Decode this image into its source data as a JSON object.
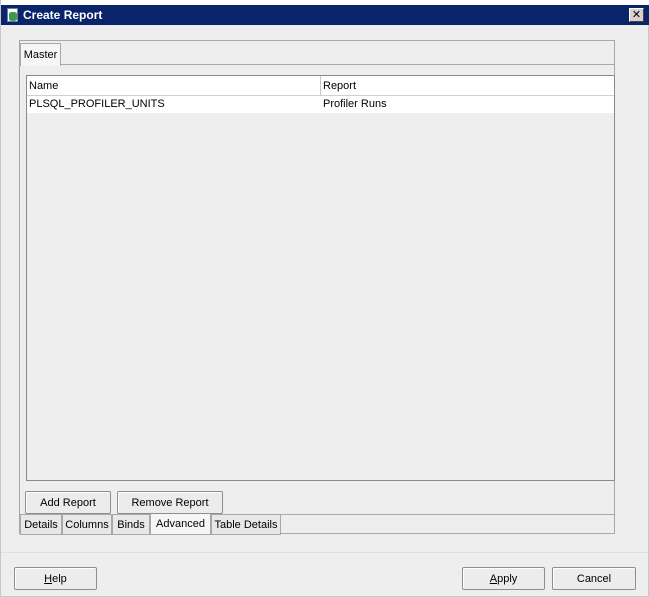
{
  "window": {
    "title": "Create Report",
    "close_glyph": "✕"
  },
  "outer_tabs": [
    {
      "label": "Master",
      "selected": true
    }
  ],
  "table": {
    "columns": [
      "Name",
      "Report"
    ],
    "rows": [
      {
        "name": "PLSQL_PROFILER_UNITS",
        "report": "Profiler Runs"
      }
    ]
  },
  "actions": {
    "add_report": "Add Report",
    "remove_report": "Remove Report"
  },
  "inner_tabs": [
    {
      "label": "Details",
      "selected": false
    },
    {
      "label": "Columns",
      "selected": false
    },
    {
      "label": "Binds",
      "selected": false
    },
    {
      "label": "Advanced",
      "selected": true
    },
    {
      "label": "Table Details",
      "selected": false
    }
  ],
  "footer": {
    "help": {
      "mnemonic": "H",
      "rest": "elp"
    },
    "apply": {
      "mnemonic": "A",
      "rest": "pply"
    },
    "cancel": "Cancel"
  },
  "colors": {
    "titlebar": "#0a246a",
    "dialog_bg": "#eeeeee"
  }
}
